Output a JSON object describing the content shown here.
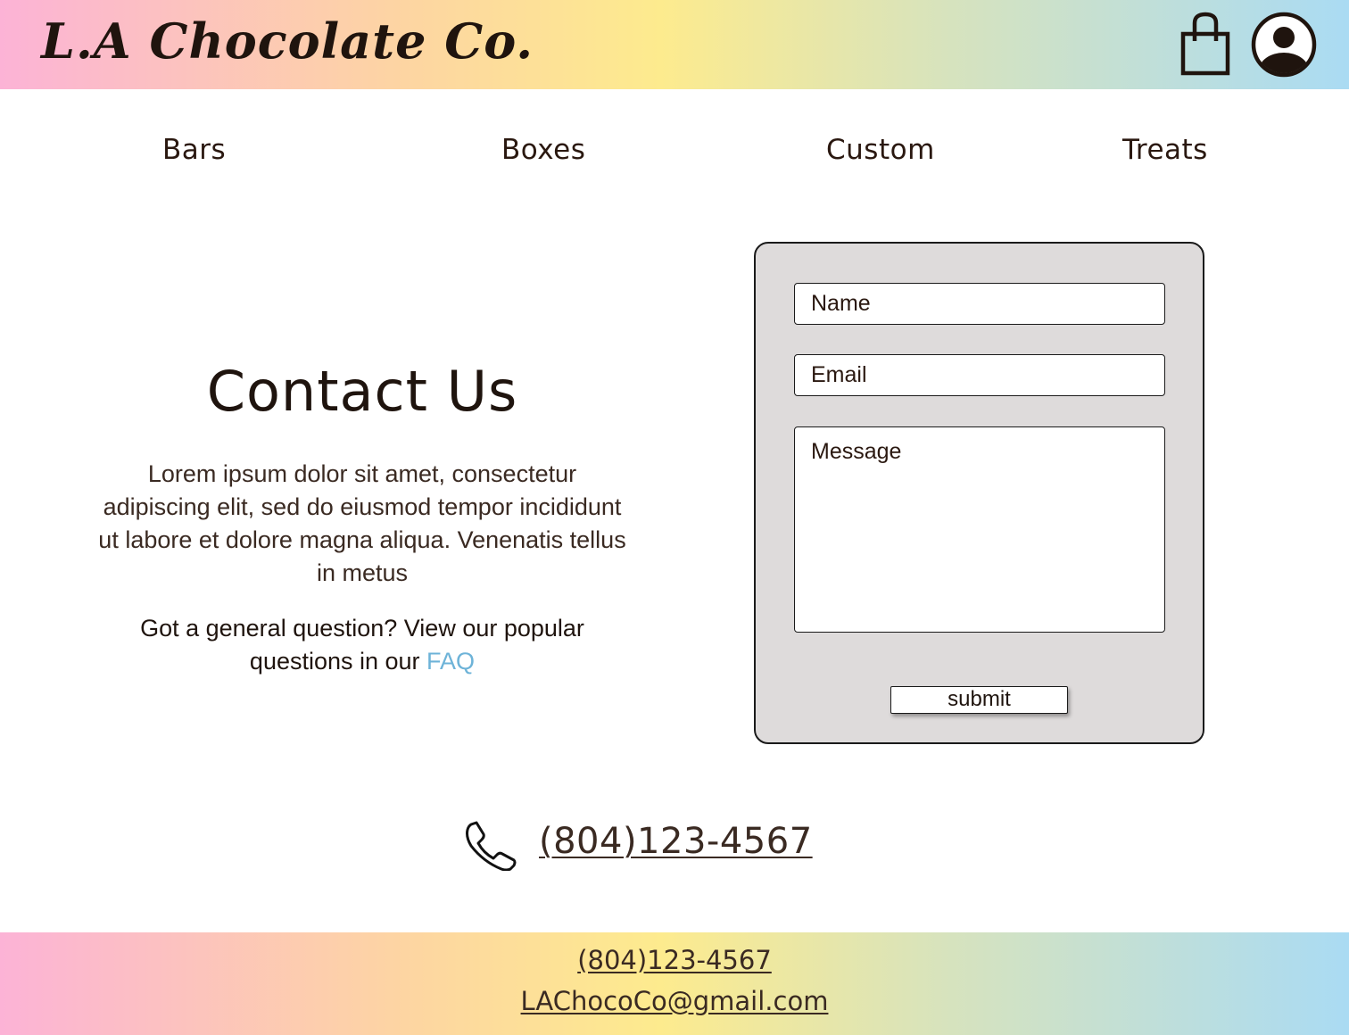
{
  "header": {
    "logo": "L.A Chocolate Co.",
    "cart_icon": "shopping-bag-icon",
    "account_icon": "user-account-icon",
    "gradient": [
      "#fcb3d6",
      "#fdd5a2",
      "#fdeb8e",
      "#d7e3bd",
      "#aadbf3"
    ]
  },
  "nav": {
    "items": [
      {
        "label": "Bars"
      },
      {
        "label": "Boxes"
      },
      {
        "label": "Custom"
      },
      {
        "label": "Treats"
      }
    ]
  },
  "contact": {
    "title": "Contact Us",
    "body": "Lorem ipsum dolor sit amet, consectetur adipiscing elit, sed do eiusmod tempor incididunt ut labore et dolore magna aliqua. Venenatis tellus in metus",
    "faq_prefix": "Got a general question? View our popular questions in our ",
    "faq_link": "FAQ",
    "faq_color": "#6db3d8"
  },
  "form": {
    "name_placeholder": "Name",
    "email_placeholder": "Email",
    "message_placeholder": "Message",
    "submit_label": "submit",
    "panel_color": "#dedbdb"
  },
  "phone": {
    "icon": "phone-icon",
    "number": "(804)123-4567"
  },
  "footer": {
    "phone": "(804)123-4567",
    "email": "LAChocoCo@gmail.com"
  }
}
